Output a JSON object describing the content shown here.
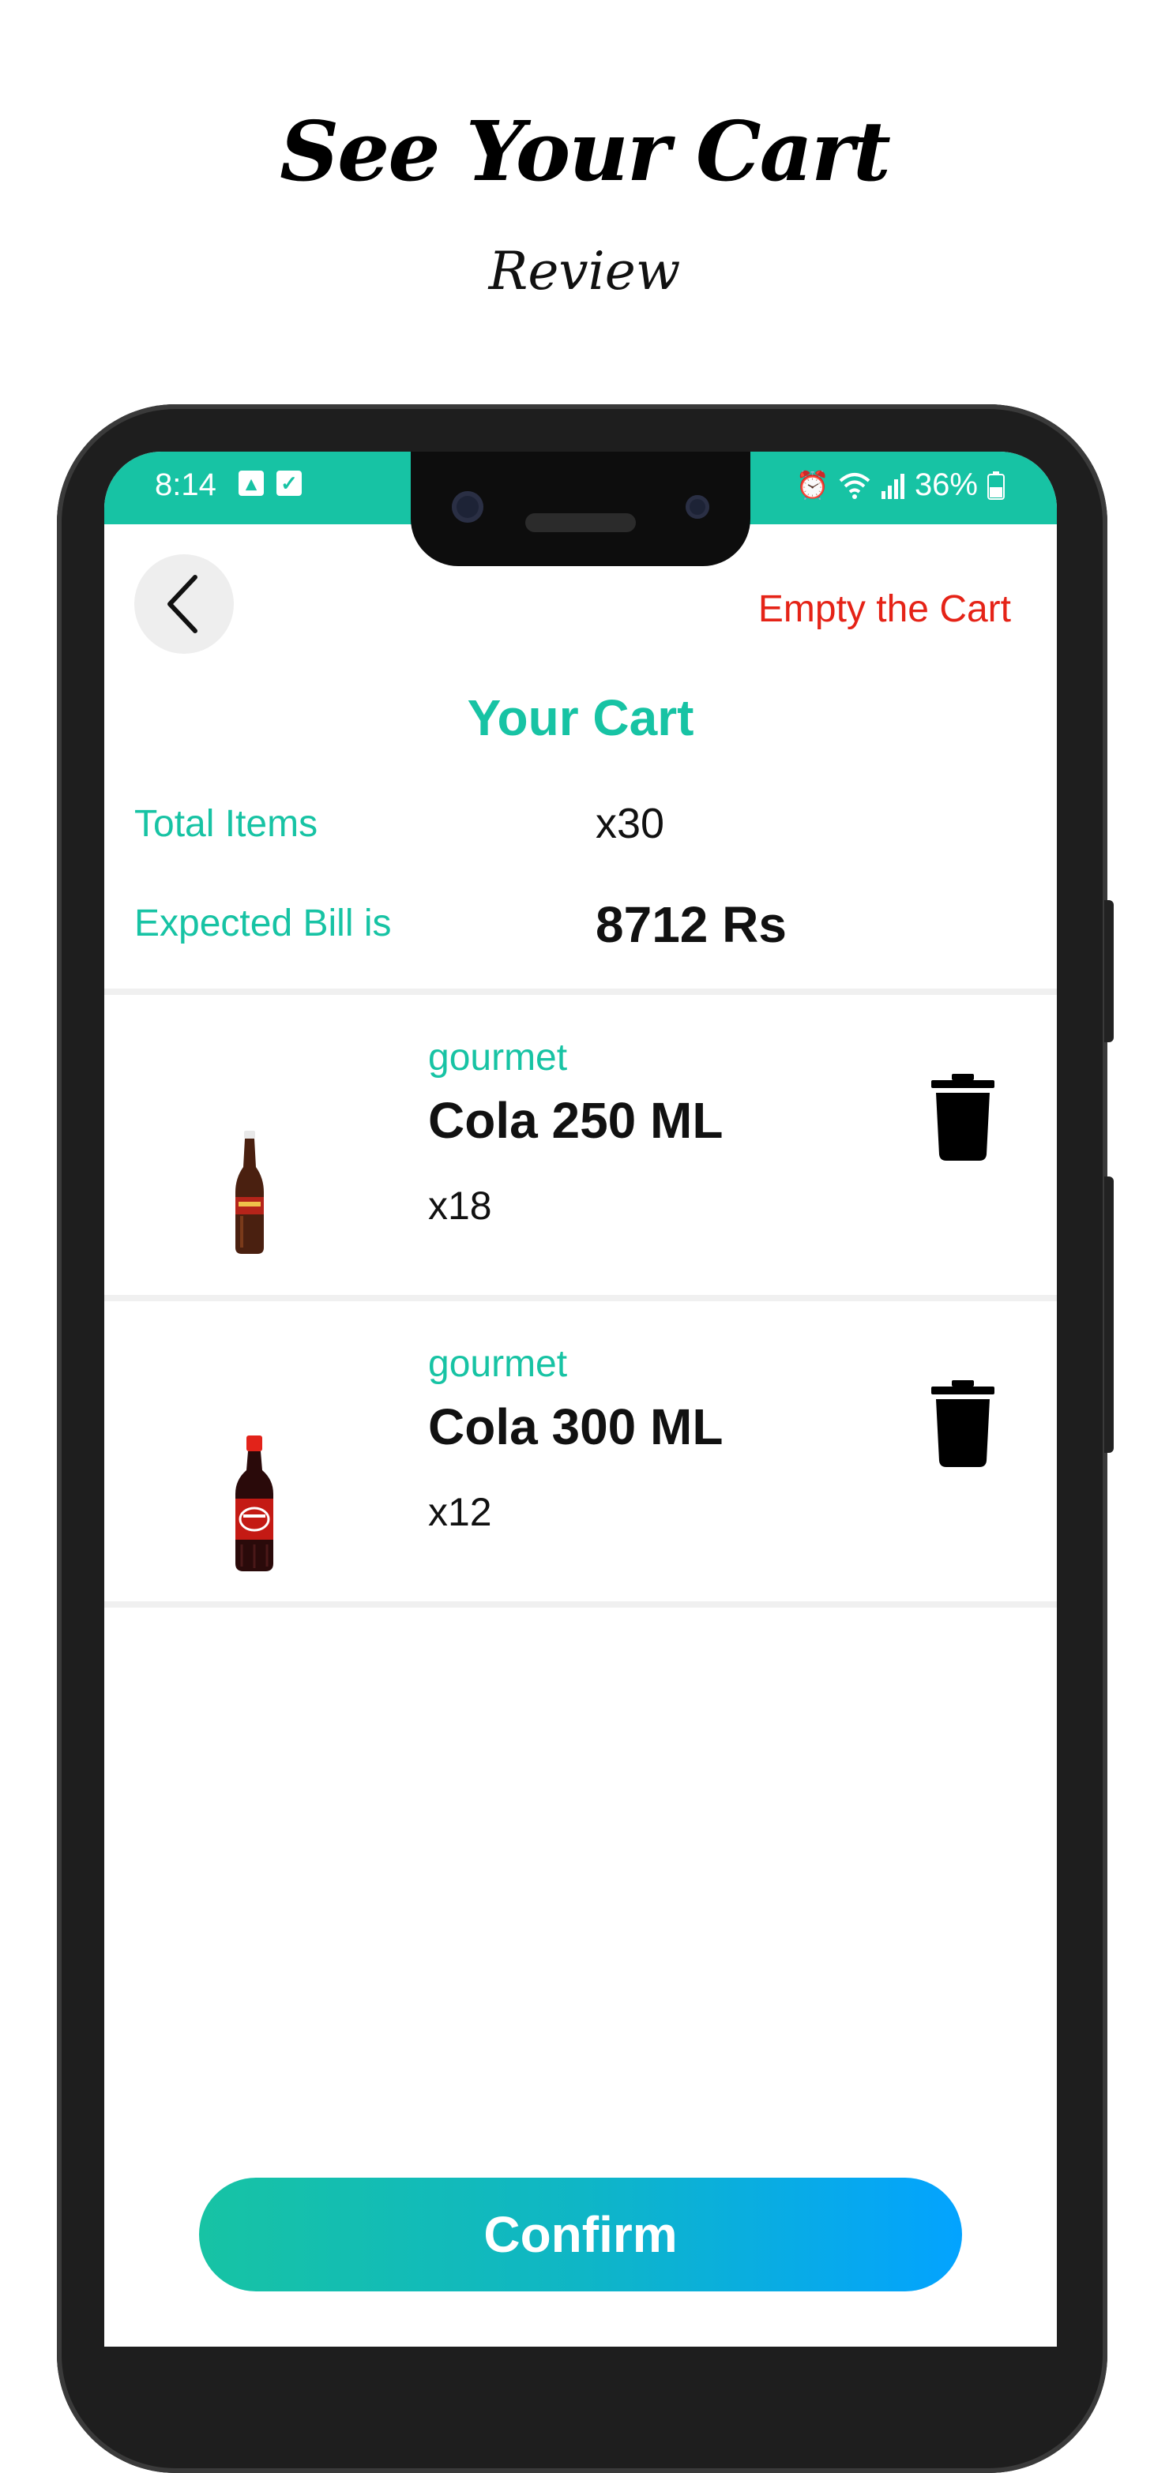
{
  "promo": {
    "title": "See Your Cart",
    "subtitle": "Review"
  },
  "status_bar": {
    "time": "8:14",
    "battery": "36%"
  },
  "header": {
    "back_icon": "chevron-left-icon",
    "empty_cart_label": "Empty the Cart"
  },
  "cart": {
    "title": "Your Cart",
    "total_items_label": "Total Items",
    "total_items_value": "x30",
    "bill_label": "Expected Bill is",
    "bill_value": "8712 Rs"
  },
  "items": [
    {
      "brand": "gourmet",
      "name": "Cola 250 ML",
      "qty": "x18",
      "image": "cola-bottle-250ml",
      "delete_icon": "trash-icon"
    },
    {
      "brand": "gourmet",
      "name": "Cola 300 ML",
      "qty": "x12",
      "image": "cola-bottle-300ml",
      "delete_icon": "trash-icon"
    }
  ],
  "footer": {
    "confirm_label": "Confirm"
  },
  "colors": {
    "accent": "#17c3a4",
    "danger": "#e52317",
    "gradient_end": "#03a3ff"
  }
}
